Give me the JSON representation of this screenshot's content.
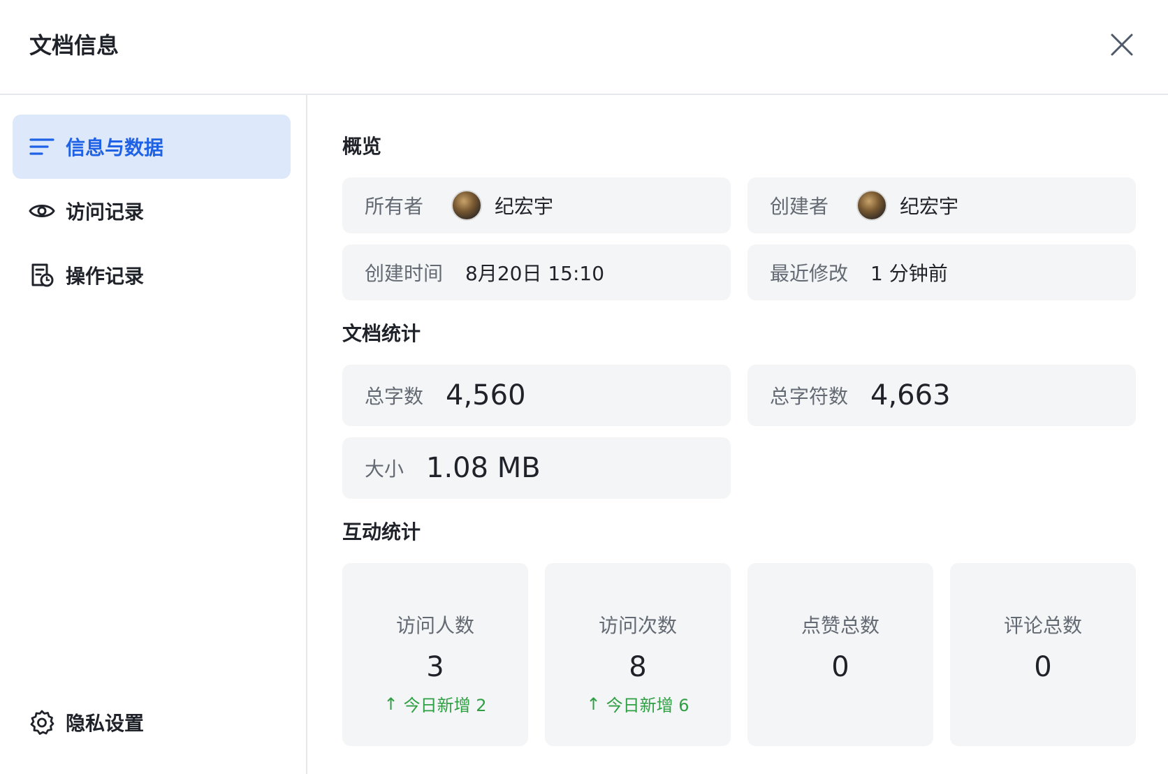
{
  "header": {
    "title": "文档信息"
  },
  "sidebar": {
    "items": [
      {
        "label": "信息与数据",
        "icon": "list-icon"
      },
      {
        "label": "访问记录",
        "icon": "eye-icon"
      },
      {
        "label": "操作记录",
        "icon": "history-doc-icon"
      }
    ],
    "bottom": {
      "label": "隐私设置",
      "icon": "gear-icon"
    }
  },
  "overview": {
    "title": "概览",
    "owner": {
      "label": "所有者",
      "name": "纪宏宇"
    },
    "creator": {
      "label": "创建者",
      "name": "纪宏宇"
    },
    "created": {
      "label": "创建时间",
      "value": "8月20日 15:10"
    },
    "modified": {
      "label": "最近修改",
      "value": "1 分钟前"
    }
  },
  "doc_stats": {
    "title": "文档统计",
    "words": {
      "label": "总字数",
      "value": "4,560"
    },
    "chars": {
      "label": "总字符数",
      "value": "4,663"
    },
    "size": {
      "label": "大小",
      "value": "1.08 MB"
    }
  },
  "interaction": {
    "title": "互动统计",
    "cards": [
      {
        "label": "访问人数",
        "value": "3",
        "delta": "今日新增 2"
      },
      {
        "label": "访问次数",
        "value": "8",
        "delta": "今日新增 6"
      },
      {
        "label": "点赞总数",
        "value": "0",
        "delta": ""
      },
      {
        "label": "评论总数",
        "value": "0",
        "delta": ""
      }
    ]
  },
  "colors": {
    "accent": "#1f62e6",
    "active_bg": "#dde8fb",
    "card_bg": "#f4f5f6",
    "positive": "#2ea043"
  }
}
